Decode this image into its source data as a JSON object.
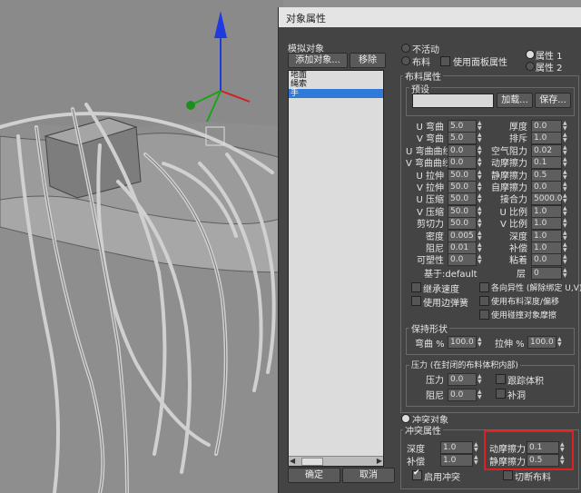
{
  "dialog": {
    "title": "对象属性",
    "simulated_objects_label": "模拟对象",
    "add_objects_label": "添加对象...",
    "remove_label": "移除",
    "objects": [
      "地面",
      "绳索",
      "手"
    ],
    "selected_index": 2,
    "ok_label": "确定",
    "cancel_label": "取消"
  },
  "mode": {
    "inactive_label": "不活动",
    "cloth_label": "布料",
    "use_panel_label": "使用面板属性",
    "prop1_label": "属性 1",
    "prop2_label": "属性 2"
  },
  "cloth_props": {
    "title": "布料属性",
    "preset_title": "预设",
    "load_label": "加载...",
    "save_label": "保存...",
    "left_fields": [
      {
        "label": "U 弯曲",
        "value": "5.0"
      },
      {
        "label": "V 弯曲",
        "value": "5.0"
      },
      {
        "label": "U 弯曲曲线",
        "value": "0.0"
      },
      {
        "label": "V 弯曲曲线",
        "value": "0.0"
      },
      {
        "label": "U 拉伸",
        "value": "50.0"
      },
      {
        "label": "V 拉伸",
        "value": "50.0"
      },
      {
        "label": "U 压缩",
        "value": "50.0"
      },
      {
        "label": "V 压缩",
        "value": "50.0"
      },
      {
        "label": "剪切力",
        "value": "50.0"
      },
      {
        "label": "密度",
        "value": "0.005"
      },
      {
        "label": "阻尼",
        "value": "0.01"
      },
      {
        "label": "可塑性",
        "value": "0.0"
      }
    ],
    "right_fields": [
      {
        "label": "厚度",
        "value": "0.0"
      },
      {
        "label": "排斥",
        "value": "1.0"
      },
      {
        "label": "空气阻力",
        "value": "0.02"
      },
      {
        "label": "动摩擦力",
        "value": "0.1"
      },
      {
        "label": "静摩擦力",
        "value": "0.5"
      },
      {
        "label": "自摩擦力",
        "value": "0.0"
      },
      {
        "label": "接合力",
        "value": "5000.0"
      },
      {
        "label": "U 比例",
        "value": "1.0"
      },
      {
        "label": "V 比例",
        "value": "1.0"
      },
      {
        "label": "深度",
        "value": "1.0"
      },
      {
        "label": "补偿",
        "value": "1.0"
      },
      {
        "label": "粘着",
        "value": "0.0"
      }
    ],
    "based_on": "基于:default",
    "layer_label": "层",
    "layer_value": "0",
    "inherit_velocity": "继承速度",
    "use_edge_springs": "使用边弹簧",
    "anisotropic": "各向异性 (解除绑定 U,V)",
    "use_cloth_depth": "使用布料深度/偏移",
    "use_collision_friction": "使用碰撞对象摩擦"
  },
  "keep_shape": {
    "title": "保持形状",
    "bend_label": "弯曲 %",
    "bend_value": "100.0",
    "stretch_label": "拉伸 %",
    "stretch_value": "100.0"
  },
  "pressure": {
    "title": "压力 (在封闭的布料体积内部)",
    "pressure_label": "压力",
    "pressure_value": "0.0",
    "damping_label": "阻尼",
    "damping_value": "0.0",
    "track_volume": "跟踪体积",
    "cap_holes": "补洞"
  },
  "collision": {
    "object_label": "冲突对象",
    "props_title": "冲突属性",
    "depth_label": "深度",
    "depth_value": "1.0",
    "offset_label": "补偿",
    "offset_value": "1.0",
    "dyn_friction_label": "动摩擦力",
    "dyn_friction_value": "0.1",
    "static_friction_label": "静摩擦力",
    "static_friction_value": "0.5",
    "enable_label": "启用冲突",
    "cut_cloth_label": "切断布料"
  }
}
